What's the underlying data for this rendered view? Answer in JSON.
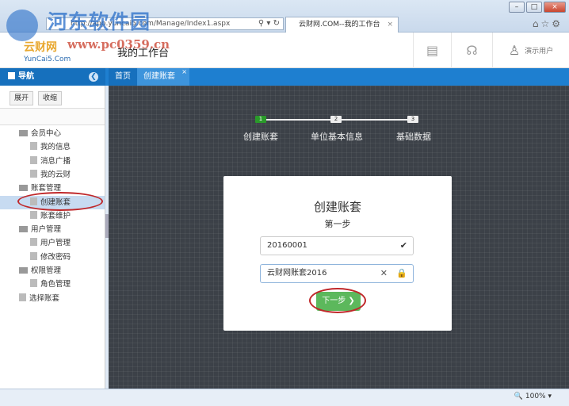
{
  "browser": {
    "url": "http://app.yuncai5.com/Manage/Index1.aspx",
    "tab_title": "云财网.COM--我的工作台",
    "tab_close": "×",
    "window_buttons": [
      "–",
      "□",
      "×"
    ],
    "toolbar_icons": [
      "home-icon",
      "star-icon",
      "gear-icon"
    ],
    "zoom": "100%"
  },
  "watermark": {
    "title": "河东软件园",
    "url": "www.pc0359.cn"
  },
  "header": {
    "logo_cn": "云财网",
    "logo_en": "YunCai5.Com",
    "title": "我的工作台",
    "user": "演示用户",
    "icons": [
      "document-icon",
      "headset-icon",
      "user-icon"
    ]
  },
  "nav": {
    "title": "导航",
    "tabs": [
      {
        "label": "首页"
      },
      {
        "label": "创建账套",
        "active": true
      }
    ]
  },
  "sidebar": {
    "expand": "展开",
    "collapse": "收缩",
    "tree": [
      {
        "label": "会员中心",
        "folder": true,
        "level": 0
      },
      {
        "label": "我的信息",
        "level": 1
      },
      {
        "label": "消息广播",
        "level": 1
      },
      {
        "label": "我的云财",
        "level": 1
      },
      {
        "label": "账套管理",
        "folder": true,
        "level": 0
      },
      {
        "label": "创建账套",
        "level": 1,
        "selected": true
      },
      {
        "label": "账套维护",
        "level": 1
      },
      {
        "label": "用户管理",
        "folder": true,
        "level": 0
      },
      {
        "label": "用户管理",
        "level": 1
      },
      {
        "label": "修改密码",
        "level": 1
      },
      {
        "label": "权限管理",
        "folder": true,
        "level": 0
      },
      {
        "label": "角色管理",
        "level": 1
      },
      {
        "label": "选择账套",
        "level": 0
      }
    ]
  },
  "wizard": {
    "steps": [
      {
        "num": "1",
        "label": "创建账套",
        "active": true
      },
      {
        "num": "2",
        "label": "单位基本信息"
      },
      {
        "num": "3",
        "label": "基础数据"
      }
    ]
  },
  "form": {
    "title": "创建账套",
    "subtitle": "第一步",
    "code_value": "20160001",
    "name_value": "云财网账套2016",
    "next_label": "下一步 ❯"
  },
  "colors": {
    "nav_blue": "#1e7fd0",
    "step_active": "#2a9a2a",
    "next_button": "#5cb85c",
    "highlight_ring": "#c0282a"
  }
}
